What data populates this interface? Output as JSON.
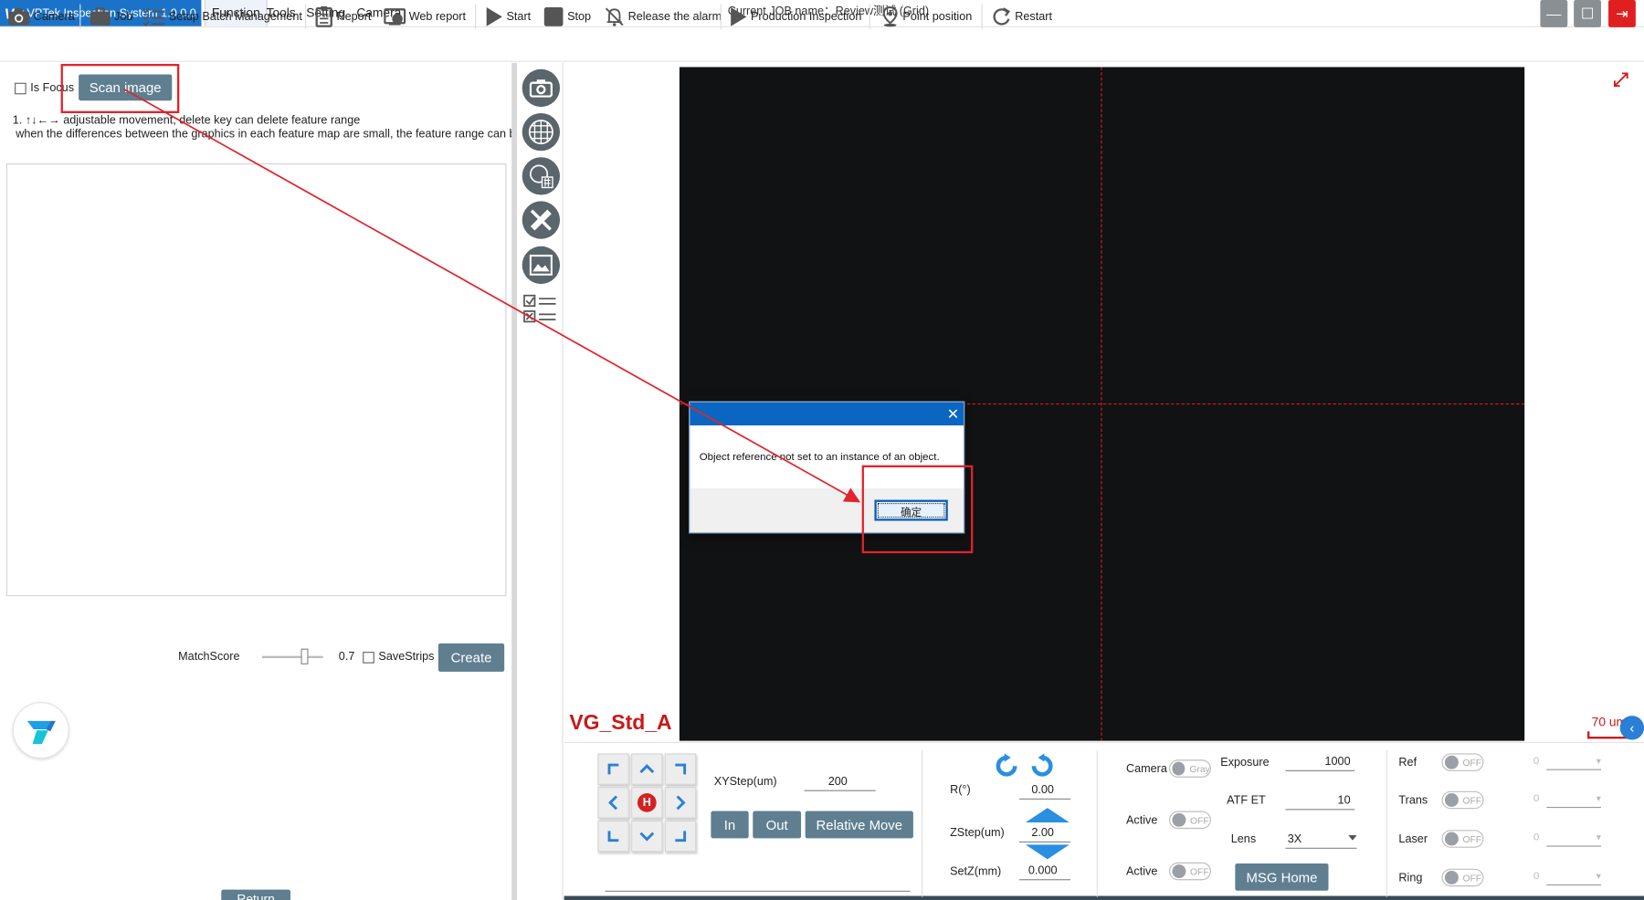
{
  "app": {
    "title": "VPTek Inspection System 1.0.0.0",
    "logo_mark": "VP",
    "job_name": "Current JOB name：Review测试 (Grid)"
  },
  "menu": {
    "function": "Function",
    "tools": "Tools",
    "setting": "Setting",
    "camera": "Camera"
  },
  "window_controls": {
    "minimize": "—",
    "maximize": "☐",
    "exit": "⇥"
  },
  "toolbar": {
    "camera": "Camera",
    "job": "Job",
    "batch": "Setup Batch Management",
    "report": "Report",
    "web_report": "Web report",
    "start": "Start",
    "stop": "Stop",
    "release_alarm": "Release the alarm",
    "production": "Production Inspection",
    "point_position": "Point position",
    "restart": "Restart"
  },
  "left_panel": {
    "is_focus": "Is Focus",
    "scan_image": "Scan image",
    "hint_line1": "1. ↑↓←→ adjustable movement, delete key can delete feature range",
    "hint_line2": "when the differences between the graphics in each feature map are small, the feature range can be",
    "match_score_label": "MatchScore",
    "match_score_value": "0.7",
    "match_score_fraction": 0.7,
    "save_strips": "SaveStrips",
    "create": "Create",
    "return": "Return"
  },
  "viewport": {
    "overlay_label": "VG_Std_A",
    "scale_label": "70 um",
    "collapse": "‹"
  },
  "dialog": {
    "close": "✕",
    "message": "Object reference not set to an instance of an object.",
    "ok": "确定"
  },
  "motion": {
    "home": "H",
    "xystep_label": "XYStep(um)",
    "xystep_value": "200",
    "in": "In",
    "out": "Out",
    "relative_move": "Relative Move"
  },
  "axis": {
    "r_label": "R(°)",
    "r_value": "0.00",
    "zstep_label": "ZStep(um)",
    "zstep_value": "2.00",
    "setz_label": "SetZ(mm)",
    "setz_value": "0.000"
  },
  "camera_ctrl": {
    "camera_label": "Camera",
    "camera_toggle": "Gray",
    "active1_label": "Active",
    "active1_toggle": "OFF",
    "active2_label": "Active",
    "active2_toggle": "OFF",
    "exposure_label": "Exposure",
    "exposure_value": "1000",
    "atf_label": "ATF ET",
    "atf_value": "10",
    "lens_label": "Lens",
    "lens_value": "3X",
    "msg_home": "MSG Home"
  },
  "lights": [
    {
      "label": "Ref",
      "toggle": "OFF",
      "value": "0"
    },
    {
      "label": "Trans",
      "toggle": "OFF",
      "value": "0"
    },
    {
      "label": "Laser",
      "toggle": "OFF",
      "value": "0"
    },
    {
      "label": "Ring",
      "toggle": "OFF",
      "value": "0"
    }
  ],
  "colors": {
    "accent_button": "#5f7f91",
    "title_blue": "#1a73c8",
    "annotation_red": "#e0242b",
    "crosshair_red": "#e01818"
  }
}
